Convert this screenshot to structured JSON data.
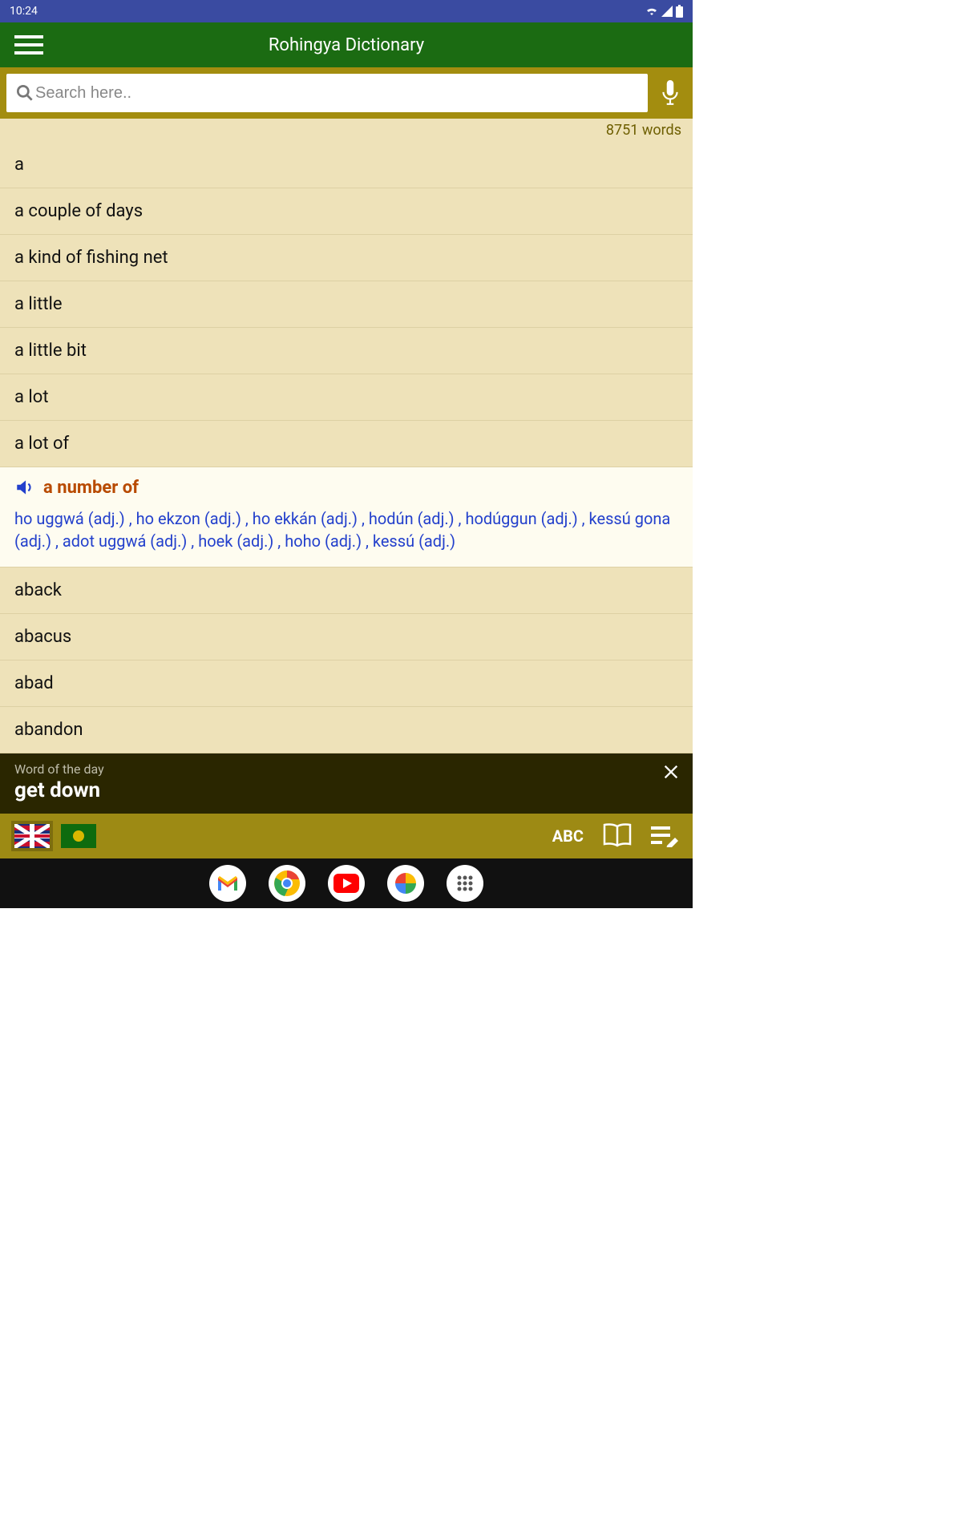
{
  "status": {
    "time": "10:24"
  },
  "header": {
    "title": "Rohingya Dictionary"
  },
  "search": {
    "placeholder": "Search here.."
  },
  "count": "8751 words",
  "rows_before": [
    "a",
    "a couple of days",
    "a kind of fishing net",
    "a little",
    "a little bit",
    "a lot",
    "a lot of"
  ],
  "expanded": {
    "word": "a number of",
    "defs": "ho uggwá (adj.) , ho ekzon (adj.) , ho ekkán (adj.) , hodún (adj.) , hodúggun (adj.) , kessú gona (adj.) , adot uggwá (adj.) , hoek (adj.) , hoho (adj.) , kessú (adj.)"
  },
  "rows_after": [
    "aback",
    "abacus",
    "abad",
    "abandon"
  ],
  "wotd": {
    "label": "Word of the day",
    "word": "get down"
  },
  "tools": {
    "abc": "ABC"
  }
}
